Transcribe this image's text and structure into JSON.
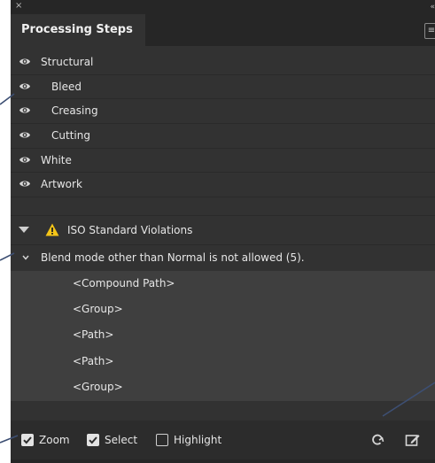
{
  "window": {
    "close_glyph": "×",
    "collapse_glyph": "«"
  },
  "tab": {
    "label": "Processing Steps",
    "menu_glyph": "≡"
  },
  "steps": [
    {
      "label": "Structural",
      "indent": 0
    },
    {
      "label": "Bleed",
      "indent": 1
    },
    {
      "label": "Creasing",
      "indent": 1
    },
    {
      "label": "Cutting",
      "indent": 1
    },
    {
      "label": "White",
      "indent": 0
    },
    {
      "label": "Artwork",
      "indent": 0
    }
  ],
  "violations": {
    "title": "ISO Standard Violations",
    "rule": "Blend mode other than Normal is not allowed (5).",
    "objects": [
      "<Compound Path>",
      "<Group>",
      "<Path>",
      "<Path>",
      "<Group>"
    ]
  },
  "footer": {
    "zoom": {
      "label": "Zoom",
      "checked": true
    },
    "select": {
      "label": "Select",
      "checked": true
    },
    "highlight": {
      "label": "Highlight",
      "checked": false
    }
  },
  "colors": {
    "panel_bg": "#323232",
    "list_bg": "#3f3f3f",
    "warning": "#f5c518",
    "callout_line": "#3d4f73"
  },
  "icons": [
    "eye-icon",
    "warning-icon",
    "refresh-icon",
    "edit-icon",
    "chevron-down-icon"
  ]
}
